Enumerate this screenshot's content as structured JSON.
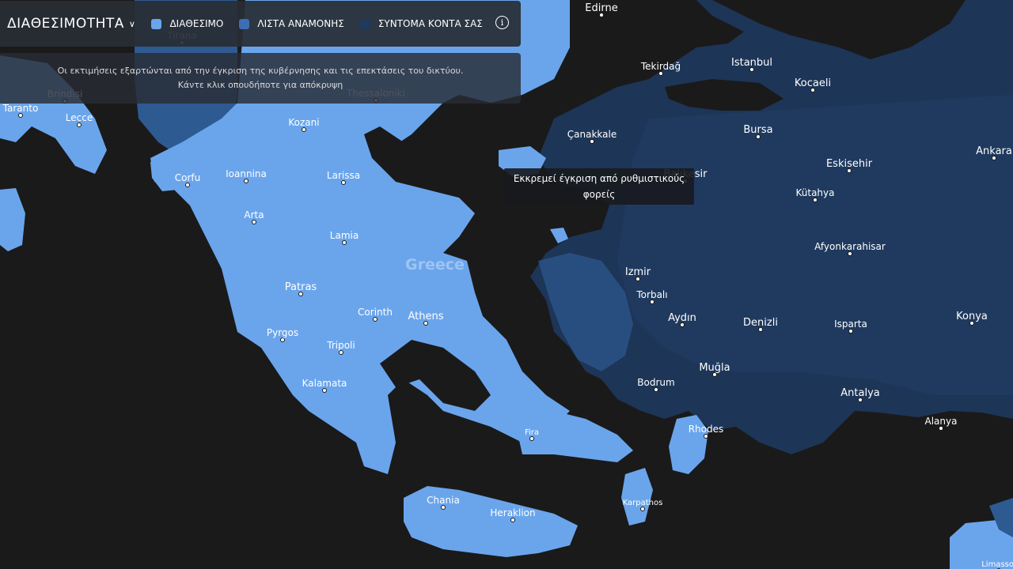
{
  "legend": {
    "title": "ΔΙΑΘΕΣΙΜΟΤΗΤΑ",
    "items": [
      {
        "label": "ΔΙΑΘΕΣΙΜΟ",
        "color": "#6aa5ec"
      },
      {
        "label": "ΛΙΣΤΑ ΑΝΑΜΟΝΗΣ",
        "color": "#3d6fb3"
      },
      {
        "label": "ΣΥΝΤΟΜΑ ΚΟΝΤΑ ΣΑΣ",
        "color": "#1f3a5f"
      }
    ],
    "info_icon": "info-icon"
  },
  "notice": {
    "line1": "Οι εκτιμήσεις εξαρτώνται από την έγκριση της κυβέρνησης και τις επεκτάσεις του δικτύου.",
    "line2": "Κάντε κλικ οπουδήποτε για απόκρυψη"
  },
  "tooltip": {
    "line1": "Εκκρεμεί έγκριση από ρυθμιστικούς",
    "line2": "φορείς"
  },
  "colors": {
    "background": "#1a1a1a",
    "available": "#6aa5ec",
    "waitlist": "#3d6fb3",
    "coming_soon": "#1f3a5f",
    "turkey_fill": "#1d3557"
  },
  "map": {
    "country_label": "Greece",
    "cities": [
      {
        "name": "Edirne"
      },
      {
        "name": "Tirana"
      },
      {
        "name": "Tekirdağ"
      },
      {
        "name": "Istanbul"
      },
      {
        "name": "Kocaeli"
      },
      {
        "name": "Brindisi"
      },
      {
        "name": "Taranto"
      },
      {
        "name": "Lecce"
      },
      {
        "name": "Thessaloniki"
      },
      {
        "name": "Kozani"
      },
      {
        "name": "Çanakkale"
      },
      {
        "name": "Bursa"
      },
      {
        "name": "Ankara"
      },
      {
        "name": "Corfu"
      },
      {
        "name": "Ioannina"
      },
      {
        "name": "Larissa"
      },
      {
        "name": "Balıkesir"
      },
      {
        "name": "Eskisehir"
      },
      {
        "name": "Kütahya"
      },
      {
        "name": "Arta"
      },
      {
        "name": "Lamia"
      },
      {
        "name": "Afyonkarahisar"
      },
      {
        "name": "Izmir"
      },
      {
        "name": "Patras"
      },
      {
        "name": "Torbalı"
      },
      {
        "name": "Corinth"
      },
      {
        "name": "Athens"
      },
      {
        "name": "Aydın"
      },
      {
        "name": "Denizli"
      },
      {
        "name": "Isparta"
      },
      {
        "name": "Konya"
      },
      {
        "name": "Pyrgos"
      },
      {
        "name": "Tripoli"
      },
      {
        "name": "Muğla"
      },
      {
        "name": "Kalamata"
      },
      {
        "name": "Bodrum"
      },
      {
        "name": "Antalya"
      },
      {
        "name": "Fira"
      },
      {
        "name": "Rhodes"
      },
      {
        "name": "Alanya"
      },
      {
        "name": "Chania"
      },
      {
        "name": "Heraklion"
      },
      {
        "name": "Karpathos"
      },
      {
        "name": "Limassol"
      }
    ]
  }
}
